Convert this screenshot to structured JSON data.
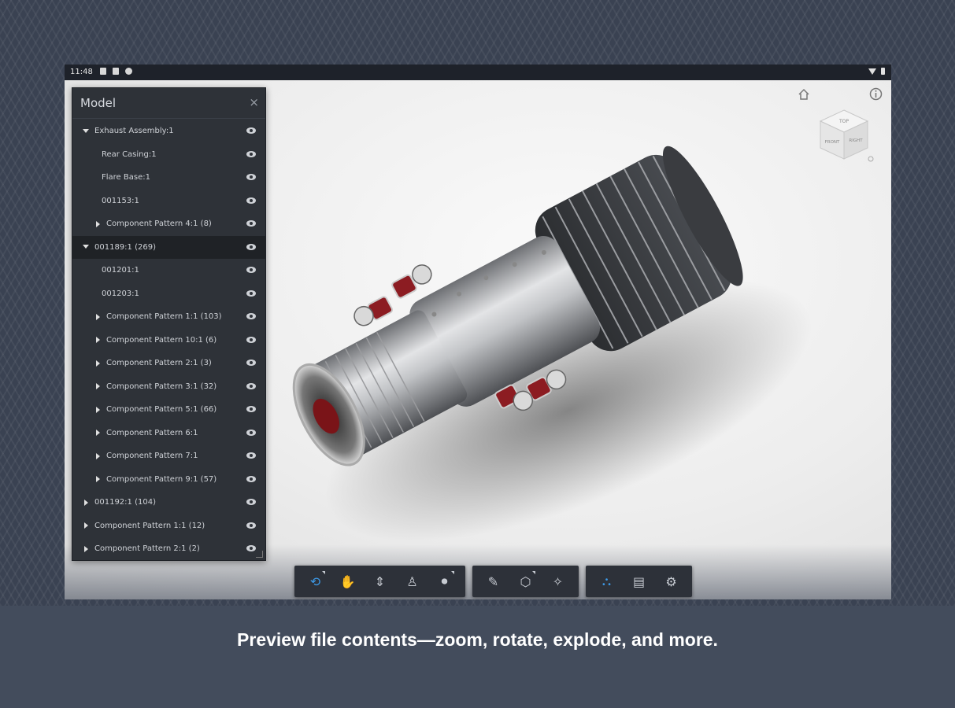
{
  "statusbar": {
    "time": "11:48"
  },
  "panel": {
    "title": "Model",
    "close_icon": "×",
    "tree": [
      {
        "label": "Exhaust Assembly:1",
        "indent": 0,
        "toggle": "down",
        "selected": false
      },
      {
        "label": "Rear Casing:1",
        "indent": 1,
        "toggle": "none",
        "selected": false
      },
      {
        "label": "Flare Base:1",
        "indent": 1,
        "toggle": "none",
        "selected": false
      },
      {
        "label": "001153:1",
        "indent": 1,
        "toggle": "none",
        "selected": false
      },
      {
        "label": "Component Pattern 4:1 (8)",
        "indent": 1,
        "toggle": "right",
        "selected": false
      },
      {
        "label": "001189:1 (269)",
        "indent": 0,
        "toggle": "down",
        "selected": true
      },
      {
        "label": "001201:1",
        "indent": 1,
        "toggle": "none",
        "selected": false
      },
      {
        "label": "001203:1",
        "indent": 1,
        "toggle": "none",
        "selected": false
      },
      {
        "label": "Component Pattern 1:1 (103)",
        "indent": 1,
        "toggle": "right",
        "selected": false
      },
      {
        "label": "Component Pattern 10:1 (6)",
        "indent": 1,
        "toggle": "right",
        "selected": false
      },
      {
        "label": "Component Pattern 2:1 (3)",
        "indent": 1,
        "toggle": "right",
        "selected": false
      },
      {
        "label": "Component Pattern 3:1 (32)",
        "indent": 1,
        "toggle": "right",
        "selected": false
      },
      {
        "label": "Component Pattern 5:1 (66)",
        "indent": 1,
        "toggle": "right",
        "selected": false
      },
      {
        "label": "Component Pattern 6:1",
        "indent": 1,
        "toggle": "right",
        "selected": false
      },
      {
        "label": "Component Pattern 7:1",
        "indent": 1,
        "toggle": "right",
        "selected": false
      },
      {
        "label": "Component Pattern 9:1 (57)",
        "indent": 1,
        "toggle": "right",
        "selected": false
      },
      {
        "label": "001192:1 (104)",
        "indent": 0,
        "toggle": "right",
        "selected": false
      },
      {
        "label": "Component Pattern 1:1 (12)",
        "indent": 0,
        "toggle": "right",
        "selected": false
      },
      {
        "label": "Component Pattern 2:1 (2)",
        "indent": 0,
        "toggle": "right",
        "selected": false
      }
    ]
  },
  "toolbar": {
    "groups": [
      [
        {
          "name": "orbit-button",
          "icon": "orbit-icon",
          "glyph": "⟲",
          "active": true,
          "corner": true
        },
        {
          "name": "pan-button",
          "icon": "hand-icon",
          "glyph": "✋",
          "active": false,
          "corner": false
        },
        {
          "name": "zoom-button",
          "icon": "zoom-arrows-icon",
          "glyph": "⇕",
          "active": false,
          "corner": false
        },
        {
          "name": "walk-button",
          "icon": "person-icon",
          "glyph": "♙",
          "active": false,
          "corner": false
        },
        {
          "name": "camera-button",
          "icon": "camera-icon",
          "glyph": "⏺",
          "active": false,
          "corner": true
        }
      ],
      [
        {
          "name": "measure-button",
          "icon": "pencil-icon",
          "glyph": "✎",
          "active": false,
          "corner": false
        },
        {
          "name": "section-button",
          "icon": "section-cube-icon",
          "glyph": "⬡",
          "active": false,
          "corner": true
        },
        {
          "name": "explode-button",
          "icon": "explode-icon",
          "glyph": "✧",
          "active": false,
          "corner": false
        }
      ],
      [
        {
          "name": "model-browser-button",
          "icon": "hierarchy-icon",
          "glyph": "⛬",
          "active": true,
          "corner": false
        },
        {
          "name": "properties-button",
          "icon": "properties-icon",
          "glyph": "▤",
          "active": false,
          "corner": false
        },
        {
          "name": "settings-button",
          "icon": "gear-icon",
          "glyph": "⚙",
          "active": false,
          "corner": false
        }
      ]
    ]
  },
  "viewcube": {
    "top": "TOP",
    "front": "FRONT",
    "right": "RIGHT"
  },
  "caption": "Preview file contents—zoom, rotate, explode, and more."
}
